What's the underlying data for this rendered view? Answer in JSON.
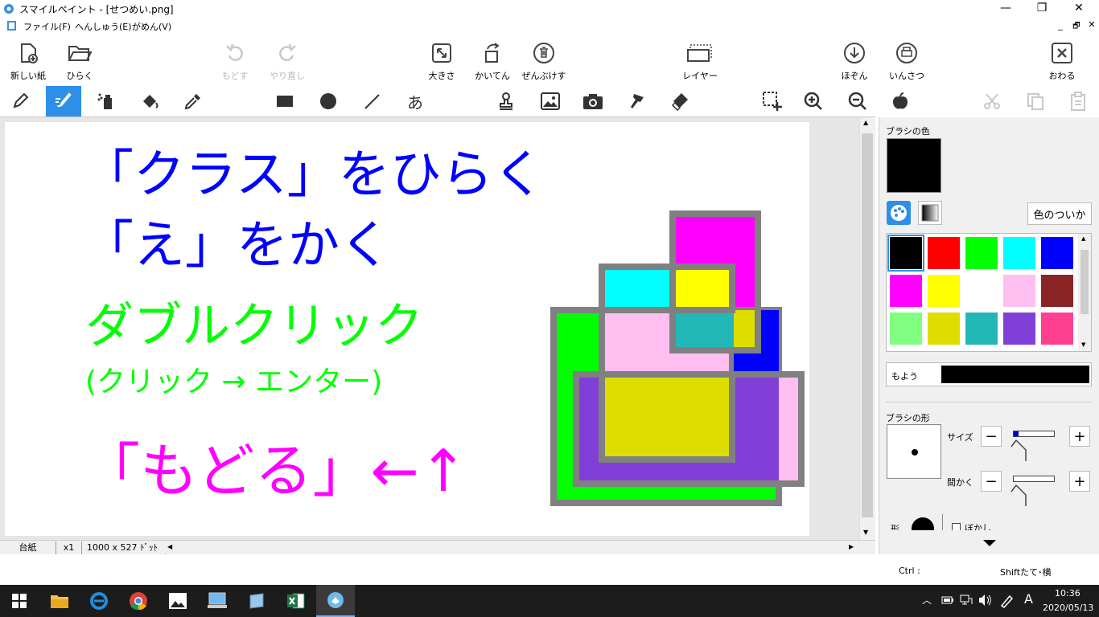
{
  "window": {
    "title": "スマイルペイント - [せつめい.png]",
    "controls": {
      "minimize": "—",
      "maximize": "❐",
      "close": "✕"
    },
    "inner_controls": {
      "minimize": "_",
      "restore": "🗗",
      "close": "✕"
    }
  },
  "menu": [
    {
      "label": "ファイル(F)"
    },
    {
      "label": "へんしゅう(E)"
    },
    {
      "label": "がめん(V)"
    }
  ],
  "toolbar": {
    "new": "新しい紙",
    "open": "ひらく",
    "undo": "もどす",
    "redo": "やり直し",
    "size": "大きさ",
    "rotate": "かいてん",
    "erase_all": "ぜんぶけす",
    "layer": "レイヤー",
    "save": "ほぞん",
    "print": "いんさつ",
    "close": "おわる"
  },
  "tools": {
    "text_tool_glyph": "あ"
  },
  "canvas": {
    "line1": "「クラス」をひらく",
    "line2": "「え」をかく",
    "line3": "ダブルクリック",
    "line4": "(クリック → エンター)",
    "line5": "「もどる」←↑",
    "colors": {
      "blue": "#0000ff",
      "green": "#00ff00",
      "magenta": "#ff00ff"
    }
  },
  "status": {
    "paper": "台紙",
    "zoom": "x1",
    "dimensions": "1000 x 527 ﾄﾞｯﾄ"
  },
  "panel": {
    "brush_color_label": "ブラシの色",
    "current_color": "#000000",
    "add_color_button": "色のついか",
    "palette": [
      "#000000",
      "#ff0000",
      "#00ff00",
      "#00ffff",
      "#0000ff",
      "#ff00ff",
      "#ffff00",
      "#ffffff",
      "#ffbff0",
      "#8b2525",
      "#80ff80",
      "#dddd00",
      "#22b8b8",
      "#8040d8",
      "#ff4090"
    ],
    "pattern_label": "もよう",
    "brush_shape_label": "ブラシの形",
    "size_label": "サイズ",
    "interval_label": "間かく",
    "shape_label": "形",
    "blur_label": "ぼかし",
    "minus": "−",
    "plus": "+"
  },
  "bottom": {
    "ctrl": "Ctrl :",
    "shift": "Shiftたて･横"
  },
  "taskbar": {
    "time": "10:36",
    "date": "2020/05/13",
    "ime": "A"
  }
}
